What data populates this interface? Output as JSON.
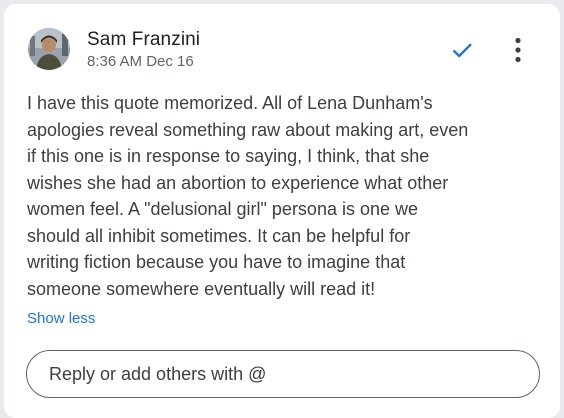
{
  "comment": {
    "author": "Sam Franzini",
    "timestamp": "8:36 AM Dec 16",
    "body_lines": [
      "I have this quote memorized. All of Lena Dunham's",
      "apologies reveal something raw about making art, even",
      "if this one is in response to saying, I think, that she",
      "wishes she had an abortion to experience what other",
      "women feel. A \"delusional girl\" persona is one we",
      "should all inhibit sometimes. It can be helpful for",
      "writing fiction because you have to imagine that",
      "someone somewhere eventually will read it!"
    ],
    "show_less_label": "Show less",
    "reply_placeholder": "Reply or add others with @"
  },
  "icons": {
    "resolve": "checkmark-icon",
    "more": "more-vert-icon"
  },
  "colors": {
    "accent": "#1a73e8",
    "text": "#3c4043",
    "secondary_text": "#5f6368",
    "card_background": "#ffffff",
    "page_background": "#e8eaed"
  }
}
